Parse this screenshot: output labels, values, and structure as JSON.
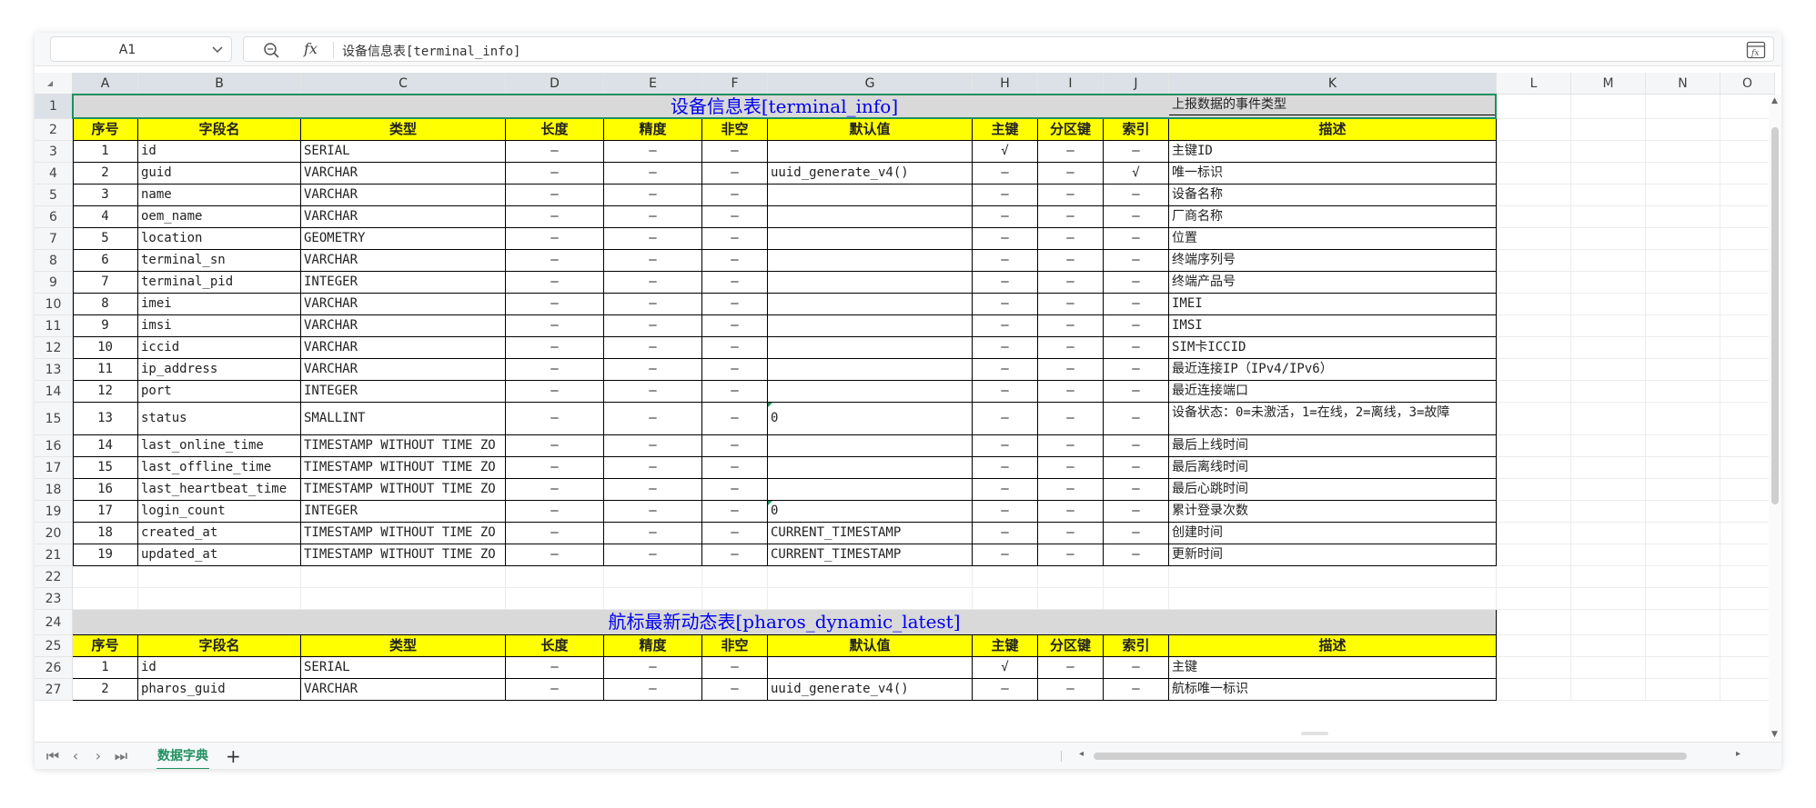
{
  "name_box": {
    "value": "A1"
  },
  "formula_bar": {
    "fx_label": "fx",
    "content": "设备信息表[terminal_info]"
  },
  "columns": [
    "A",
    "B",
    "C",
    "D",
    "E",
    "F",
    "G",
    "H",
    "I",
    "J",
    "K",
    "L",
    "M",
    "N",
    "O"
  ],
  "rows": [
    "1",
    "2",
    "3",
    "4",
    "5",
    "6",
    "7",
    "8",
    "9",
    "10",
    "11",
    "12",
    "13",
    "14",
    "15",
    "16",
    "17",
    "18",
    "19",
    "20",
    "21",
    "22",
    "23",
    "24",
    "25",
    "26",
    "27"
  ],
  "header_labels": [
    "序号",
    "字段名",
    "类型",
    "长度",
    "精度",
    "非空",
    "默认值",
    "主键",
    "分区键",
    "索引",
    "描述"
  ],
  "table1": {
    "title": "设备信息表[terminal_info]",
    "records": [
      [
        "1",
        "id",
        "SERIAL",
        "–",
        "–",
        "–",
        "",
        "√",
        "–",
        "–",
        "主键ID"
      ],
      [
        "2",
        "guid",
        "VARCHAR",
        "–",
        "–",
        "–",
        "uuid_generate_v4()",
        "–",
        "–",
        "√",
        "唯一标识"
      ],
      [
        "3",
        "name",
        "VARCHAR",
        "–",
        "–",
        "–",
        "",
        "–",
        "–",
        "–",
        "设备名称"
      ],
      [
        "4",
        "oem_name",
        "VARCHAR",
        "–",
        "–",
        "–",
        "",
        "–",
        "–",
        "–",
        "厂商名称"
      ],
      [
        "5",
        "location",
        "GEOMETRY",
        "–",
        "–",
        "–",
        "",
        "–",
        "–",
        "–",
        "位置"
      ],
      [
        "6",
        "terminal_sn",
        "VARCHAR",
        "–",
        "–",
        "–",
        "",
        "–",
        "–",
        "–",
        "终端序列号"
      ],
      [
        "7",
        "terminal_pid",
        "INTEGER",
        "–",
        "–",
        "–",
        "",
        "–",
        "–",
        "–",
        "终端产品号"
      ],
      [
        "8",
        "imei",
        "VARCHAR",
        "–",
        "–",
        "–",
        "",
        "–",
        "–",
        "–",
        "IMEI"
      ],
      [
        "9",
        "imsi",
        "VARCHAR",
        "–",
        "–",
        "–",
        "",
        "–",
        "–",
        "–",
        "IMSI"
      ],
      [
        "10",
        "iccid",
        "VARCHAR",
        "–",
        "–",
        "–",
        "",
        "–",
        "–",
        "–",
        "SIM卡ICCID"
      ],
      [
        "11",
        "ip_address",
        "VARCHAR",
        "–",
        "–",
        "–",
        "",
        "–",
        "–",
        "–",
        "最近连接IP（IPv4/IPv6）"
      ],
      [
        "12",
        "port",
        "INTEGER",
        "–",
        "–",
        "–",
        "",
        "–",
        "–",
        "–",
        "最近连接端口"
      ],
      [
        "13",
        "status",
        "SMALLINT",
        "–",
        "–",
        "–",
        "0",
        "–",
        "–",
        "–",
        "设备状态：0=未激活，1=在线，2=离线，3=故障"
      ],
      [
        "14",
        "last_online_time",
        "TIMESTAMP WITHOUT TIME ZO",
        "–",
        "–",
        "–",
        "",
        "–",
        "–",
        "–",
        "最后上线时间"
      ],
      [
        "15",
        "last_offline_time",
        "TIMESTAMP WITHOUT TIME ZO",
        "–",
        "–",
        "–",
        "",
        "–",
        "–",
        "–",
        "最后离线时间"
      ],
      [
        "16",
        "last_heartbeat_time",
        "TIMESTAMP WITHOUT TIME ZO",
        "–",
        "–",
        "–",
        "",
        "–",
        "–",
        "–",
        "最后心跳时间"
      ],
      [
        "17",
        "login_count",
        "INTEGER",
        "–",
        "–",
        "–",
        "0",
        "–",
        "–",
        "–",
        "累计登录次数"
      ],
      [
        "18",
        "created_at",
        "TIMESTAMP WITHOUT TIME ZO",
        "–",
        "–",
        "–",
        "CURRENT_TIMESTAMP",
        "–",
        "–",
        "–",
        "创建时间"
      ],
      [
        "19",
        "updated_at",
        "TIMESTAMP WITHOUT TIME ZO",
        "–",
        "–",
        "–",
        "CURRENT_TIMESTAMP",
        "–",
        "–",
        "–",
        "更新时间"
      ]
    ]
  },
  "table2": {
    "title": "航标最新动态表[pharos_dynamic_latest]",
    "records": [
      [
        "1",
        "id",
        "SERIAL",
        "–",
        "–",
        "–",
        "",
        "√",
        "–",
        "–",
        "主键"
      ],
      [
        "2",
        "pharos_guid",
        "VARCHAR",
        "–",
        "–",
        "–",
        "uuid_generate_v4()",
        "–",
        "–",
        "–",
        "航标唯一标识"
      ],
      [
        "",
        "",
        "",
        "",
        "",
        "",
        "",
        "",
        "",
        "",
        "上报数据的事件类型"
      ]
    ]
  },
  "sheet_tabs": [
    {
      "label": "数据字典",
      "active": true
    }
  ],
  "add_sheet_label": "+",
  "icons": [
    "zoom-icon",
    "fx-icon",
    "chevron-down-icon",
    "formula-toggle-icon",
    "first-sheet-icon",
    "prev-sheet-icon",
    "next-sheet-icon",
    "last-sheet-icon",
    "add-sheet-icon"
  ],
  "colors": {
    "header_yellow": "#ffff00",
    "title_gray": "#d9d9d9",
    "title_blue": "#0000ee",
    "accent_green": "#1f8f5f"
  }
}
